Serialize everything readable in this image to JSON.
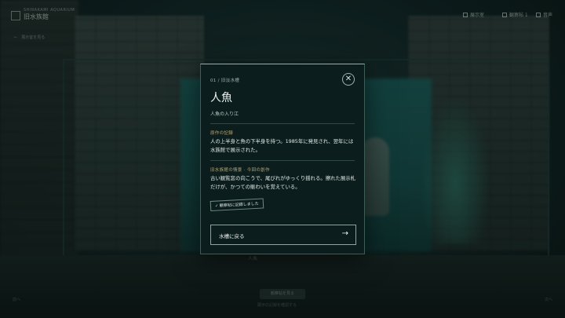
{
  "app": {
    "brand_sub": "SHIRAKAMI AQUARIUM",
    "brand_title": "旧水族館",
    "subnav": "←　展示室を見る"
  },
  "topbar": {
    "items": [
      {
        "label": "展示室"
      },
      {
        "label": "観察帖 1"
      },
      {
        "label": "音声"
      }
    ]
  },
  "scene": {
    "tank_tag": "人魚",
    "bottom_pill": "観察帖を見る",
    "bottom_note": "展示の記録を確認する",
    "corner_left": "前へ",
    "corner_right": "次へ"
  },
  "modal": {
    "breadcrumb": "01 / 旧淡水槽",
    "close_label": "✕",
    "title": "人魚",
    "subtitle": "人魚の入り江",
    "section1": {
      "heading": "原作の記録",
      "body": "人の上半身と魚の下半身を持つ。1985年に発見され、翌年には水族館で展示された。"
    },
    "section2": {
      "heading": "旧水族館の情景 · 今回の創作",
      "body": "古い観覧窓の向こうで、尾びれがゆっくり揺れる。擦れた展示札だけが、かつての賑わいを覚えている。"
    },
    "stamp": "✓ 観察帖に記録しました",
    "back_button": {
      "label": "水槽に戻る",
      "arrow": "→"
    }
  }
}
